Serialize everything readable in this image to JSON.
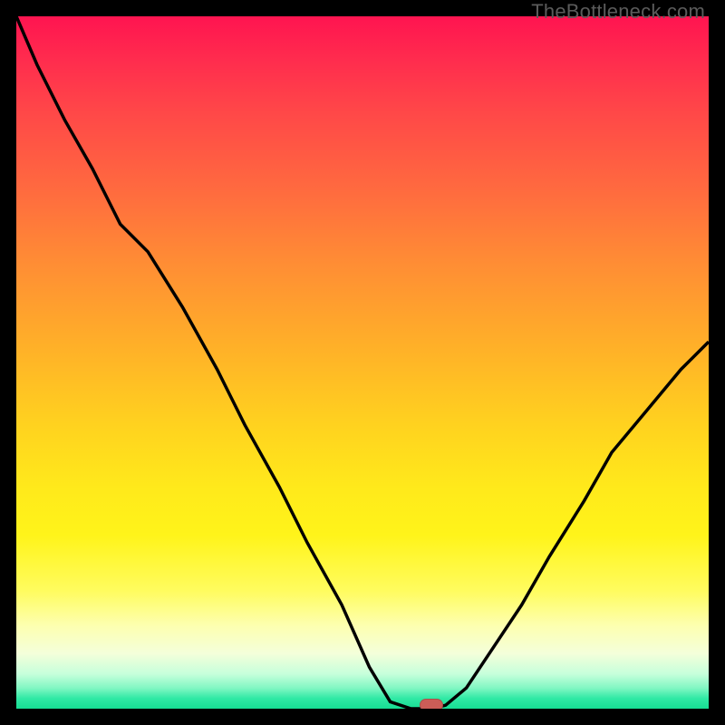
{
  "watermark": "TheBottleneck.com",
  "marker": {
    "x_frac": 0.6,
    "y_frac": 0.0
  },
  "chart_data": {
    "type": "line",
    "title": "",
    "xlabel": "",
    "ylabel": "",
    "xlim": [
      0,
      1
    ],
    "ylim": [
      0,
      1
    ],
    "x": [
      0.0,
      0.03,
      0.07,
      0.11,
      0.15,
      0.19,
      0.24,
      0.29,
      0.33,
      0.38,
      0.42,
      0.47,
      0.51,
      0.54,
      0.57,
      0.6,
      0.62,
      0.65,
      0.69,
      0.73,
      0.77,
      0.82,
      0.86,
      0.91,
      0.96,
      1.0
    ],
    "values": [
      1.0,
      0.93,
      0.85,
      0.78,
      0.7,
      0.66,
      0.58,
      0.49,
      0.41,
      0.32,
      0.24,
      0.15,
      0.06,
      0.01,
      0.0,
      0.0,
      0.005,
      0.03,
      0.09,
      0.15,
      0.22,
      0.3,
      0.37,
      0.43,
      0.49,
      0.53
    ],
    "annotations": [
      {
        "text": "TheBottleneck.com",
        "position": "top-right"
      }
    ],
    "marker": {
      "x": 0.6,
      "y": 0.0,
      "shape": "pill",
      "color": "#cb5d57"
    }
  }
}
